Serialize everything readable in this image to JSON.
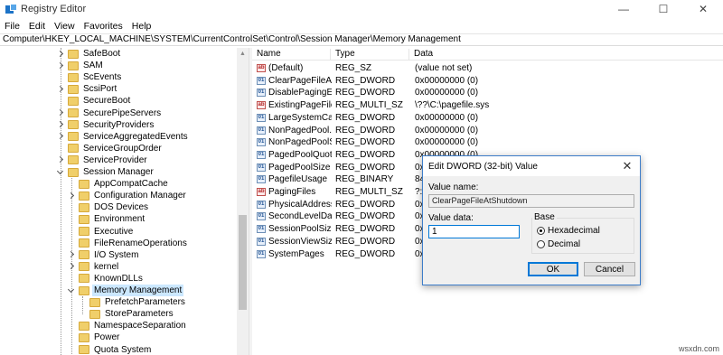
{
  "window": {
    "title": "Registry Editor",
    "app_icon": "registry-editor-icon",
    "controls": [
      "minimize-icon",
      "maximize-icon",
      "close-icon"
    ],
    "control_glyphs": [
      "—",
      "☐",
      "✕"
    ]
  },
  "menu": [
    "File",
    "Edit",
    "View",
    "Favorites",
    "Help"
  ],
  "address": "Computer\\HKEY_LOCAL_MACHINE\\SYSTEM\\CurrentControlSet\\Control\\Session Manager\\Memory Management",
  "tree": [
    {
      "label": "SafeBoot",
      "expander": "right",
      "level": 0
    },
    {
      "label": "SAM",
      "expander": "right",
      "level": 0
    },
    {
      "label": "ScEvents",
      "expander": "none",
      "level": 0
    },
    {
      "label": "ScsiPort",
      "expander": "right",
      "level": 0
    },
    {
      "label": "SecureBoot",
      "expander": "none",
      "level": 0
    },
    {
      "label": "SecurePipeServers",
      "expander": "right",
      "level": 0
    },
    {
      "label": "SecurityProviders",
      "expander": "right",
      "level": 0
    },
    {
      "label": "ServiceAggregatedEvents",
      "expander": "right",
      "level": 0
    },
    {
      "label": "ServiceGroupOrder",
      "expander": "none",
      "level": 0
    },
    {
      "label": "ServiceProvider",
      "expander": "right",
      "level": 0
    },
    {
      "label": "Session Manager",
      "expander": "down",
      "level": 0
    },
    {
      "label": "AppCompatCache",
      "expander": "none",
      "level": 1
    },
    {
      "label": "Configuration Manager",
      "expander": "right",
      "level": 1
    },
    {
      "label": "DOS Devices",
      "expander": "none",
      "level": 1
    },
    {
      "label": "Environment",
      "expander": "none",
      "level": 1
    },
    {
      "label": "Executive",
      "expander": "none",
      "level": 1
    },
    {
      "label": "FileRenameOperations",
      "expander": "none",
      "level": 1
    },
    {
      "label": "I/O System",
      "expander": "right",
      "level": 1
    },
    {
      "label": "kernel",
      "expander": "right",
      "level": 1
    },
    {
      "label": "KnownDLLs",
      "expander": "none",
      "level": 1
    },
    {
      "label": "Memory Management",
      "expander": "down",
      "level": 1,
      "selected": true
    },
    {
      "label": "PrefetchParameters",
      "expander": "none",
      "level": 2
    },
    {
      "label": "StoreParameters",
      "expander": "none",
      "level": 2
    },
    {
      "label": "NamespaceSeparation",
      "expander": "none",
      "level": 1
    },
    {
      "label": "Power",
      "expander": "none",
      "level": 1
    },
    {
      "label": "Quota System",
      "expander": "none",
      "level": 1
    }
  ],
  "list": {
    "columns": [
      "Name",
      "Type",
      "Data"
    ],
    "rows": [
      {
        "name": "(Default)",
        "type": "REG_SZ",
        "data": "(value not set)",
        "icon": "string-value-icon"
      },
      {
        "name": "ClearPageFileAt...",
        "type": "REG_DWORD",
        "data": "0x00000000 (0)",
        "icon": "binary-value-icon"
      },
      {
        "name": "DisablePagingEx...",
        "type": "REG_DWORD",
        "data": "0x00000000 (0)",
        "icon": "binary-value-icon"
      },
      {
        "name": "ExistingPageFiles",
        "type": "REG_MULTI_SZ",
        "data": "\\??\\C:\\pagefile.sys",
        "icon": "string-value-icon"
      },
      {
        "name": "LargeSystemCac...",
        "type": "REG_DWORD",
        "data": "0x00000000 (0)",
        "icon": "binary-value-icon"
      },
      {
        "name": "NonPagedPool...",
        "type": "REG_DWORD",
        "data": "0x00000000 (0)",
        "icon": "binary-value-icon"
      },
      {
        "name": "NonPagedPoolS...",
        "type": "REG_DWORD",
        "data": "0x00000000 (0)",
        "icon": "binary-value-icon"
      },
      {
        "name": "PagedPoolQuota",
        "type": "REG_DWORD",
        "data": "0x00000000 (0)",
        "icon": "binary-value-icon"
      },
      {
        "name": "PagedPoolSize",
        "type": "REG_DWORD",
        "data": "0x",
        "icon": "binary-value-icon"
      },
      {
        "name": "PagefileUsage",
        "type": "REG_BINARY",
        "data": "84",
        "icon": "binary-value-icon"
      },
      {
        "name": "PagingFiles",
        "type": "REG_MULTI_SZ",
        "data": "?:",
        "icon": "string-value-icon"
      },
      {
        "name": "PhysicalAddress...",
        "type": "REG_DWORD",
        "data": "0x",
        "icon": "binary-value-icon"
      },
      {
        "name": "SecondLevelDat...",
        "type": "REG_DWORD",
        "data": "0x",
        "icon": "binary-value-icon"
      },
      {
        "name": "SessionPoolSize",
        "type": "REG_DWORD",
        "data": "0x",
        "icon": "binary-value-icon"
      },
      {
        "name": "SessionViewSize",
        "type": "REG_DWORD",
        "data": "0x",
        "icon": "binary-value-icon"
      },
      {
        "name": "SystemPages",
        "type": "REG_DWORD",
        "data": "0x",
        "icon": "binary-value-icon"
      }
    ]
  },
  "dialog": {
    "title": "Edit DWORD (32-bit) Value",
    "close_glyph": "✕",
    "value_name_label": "Value name:",
    "value_name": "ClearPageFileAtShutdown",
    "value_data_label": "Value data:",
    "value_data": "1",
    "base_label": "Base",
    "hex_label": "Hexadecimal",
    "dec_label": "Decimal",
    "selected_base": "Hexadecimal",
    "ok_label": "OK",
    "cancel_label": "Cancel"
  },
  "watermark": "wsxdn.com"
}
